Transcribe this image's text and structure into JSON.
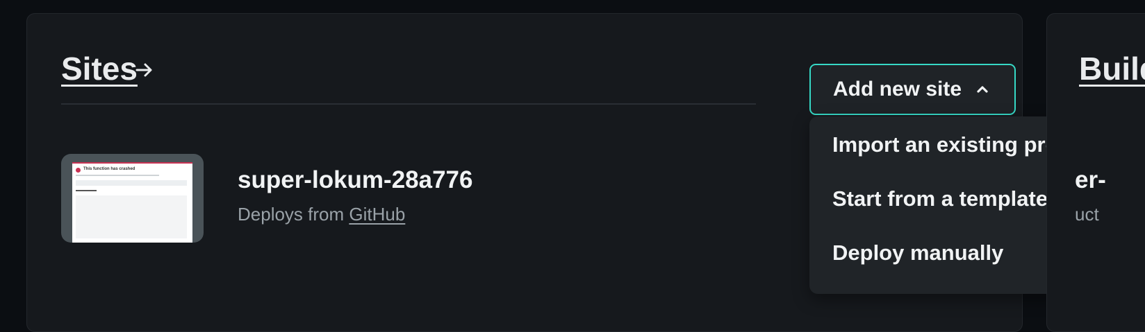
{
  "sites": {
    "title": "Sites",
    "add_button_label": "Add new site",
    "menu_items": [
      "Import an existing project",
      "Start from a template",
      "Deploy manually"
    ],
    "site": {
      "name": "super-lokum-28a776",
      "deploys_prefix": "Deploys from",
      "deploys_source": "GitHub",
      "thumbnail_title": "This function has crashed"
    }
  },
  "builds": {
    "title_visible": "Build",
    "peek_line1": "er-",
    "peek_line2": "uct"
  },
  "colors": {
    "background": "#0b0e12",
    "card": "#16191d",
    "accent_teal": "#36d9c6",
    "text_primary": "#f1f3f4",
    "text_muted": "#9aa2a8"
  }
}
